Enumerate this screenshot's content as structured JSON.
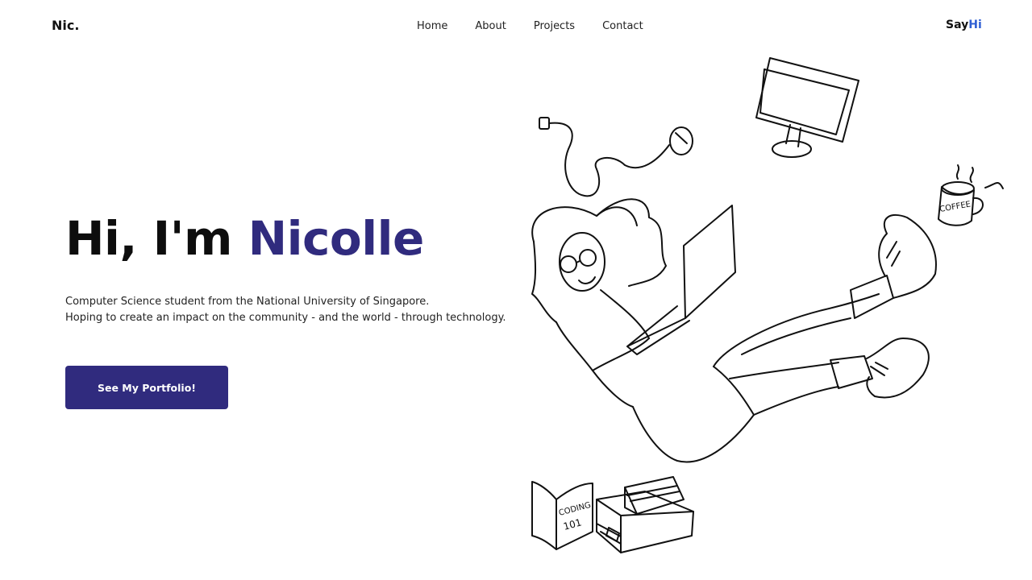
{
  "brand": {
    "logo": "Nic."
  },
  "nav": {
    "items": [
      "Home",
      "About",
      "Projects",
      "Contact"
    ]
  },
  "say_hi": {
    "prefix": "Say",
    "accent": "Hi"
  },
  "hero": {
    "greeting": "Hi, I'm",
    "name": "Nicolle",
    "tagline_line1": "Computer Science student from the National University of Singapore.",
    "tagline_line2": "Hoping to create an impact on the community - and the world - through technology.",
    "cta_label": "See My Portfolio!"
  },
  "illustration": {
    "book_text_line1": "CODING",
    "book_text_line2": "101",
    "mug_text": "COFFEE"
  },
  "colors": {
    "brand_purple": "#302b7e",
    "hi_accent": "#2f5fd3",
    "background": "#ffffff"
  }
}
